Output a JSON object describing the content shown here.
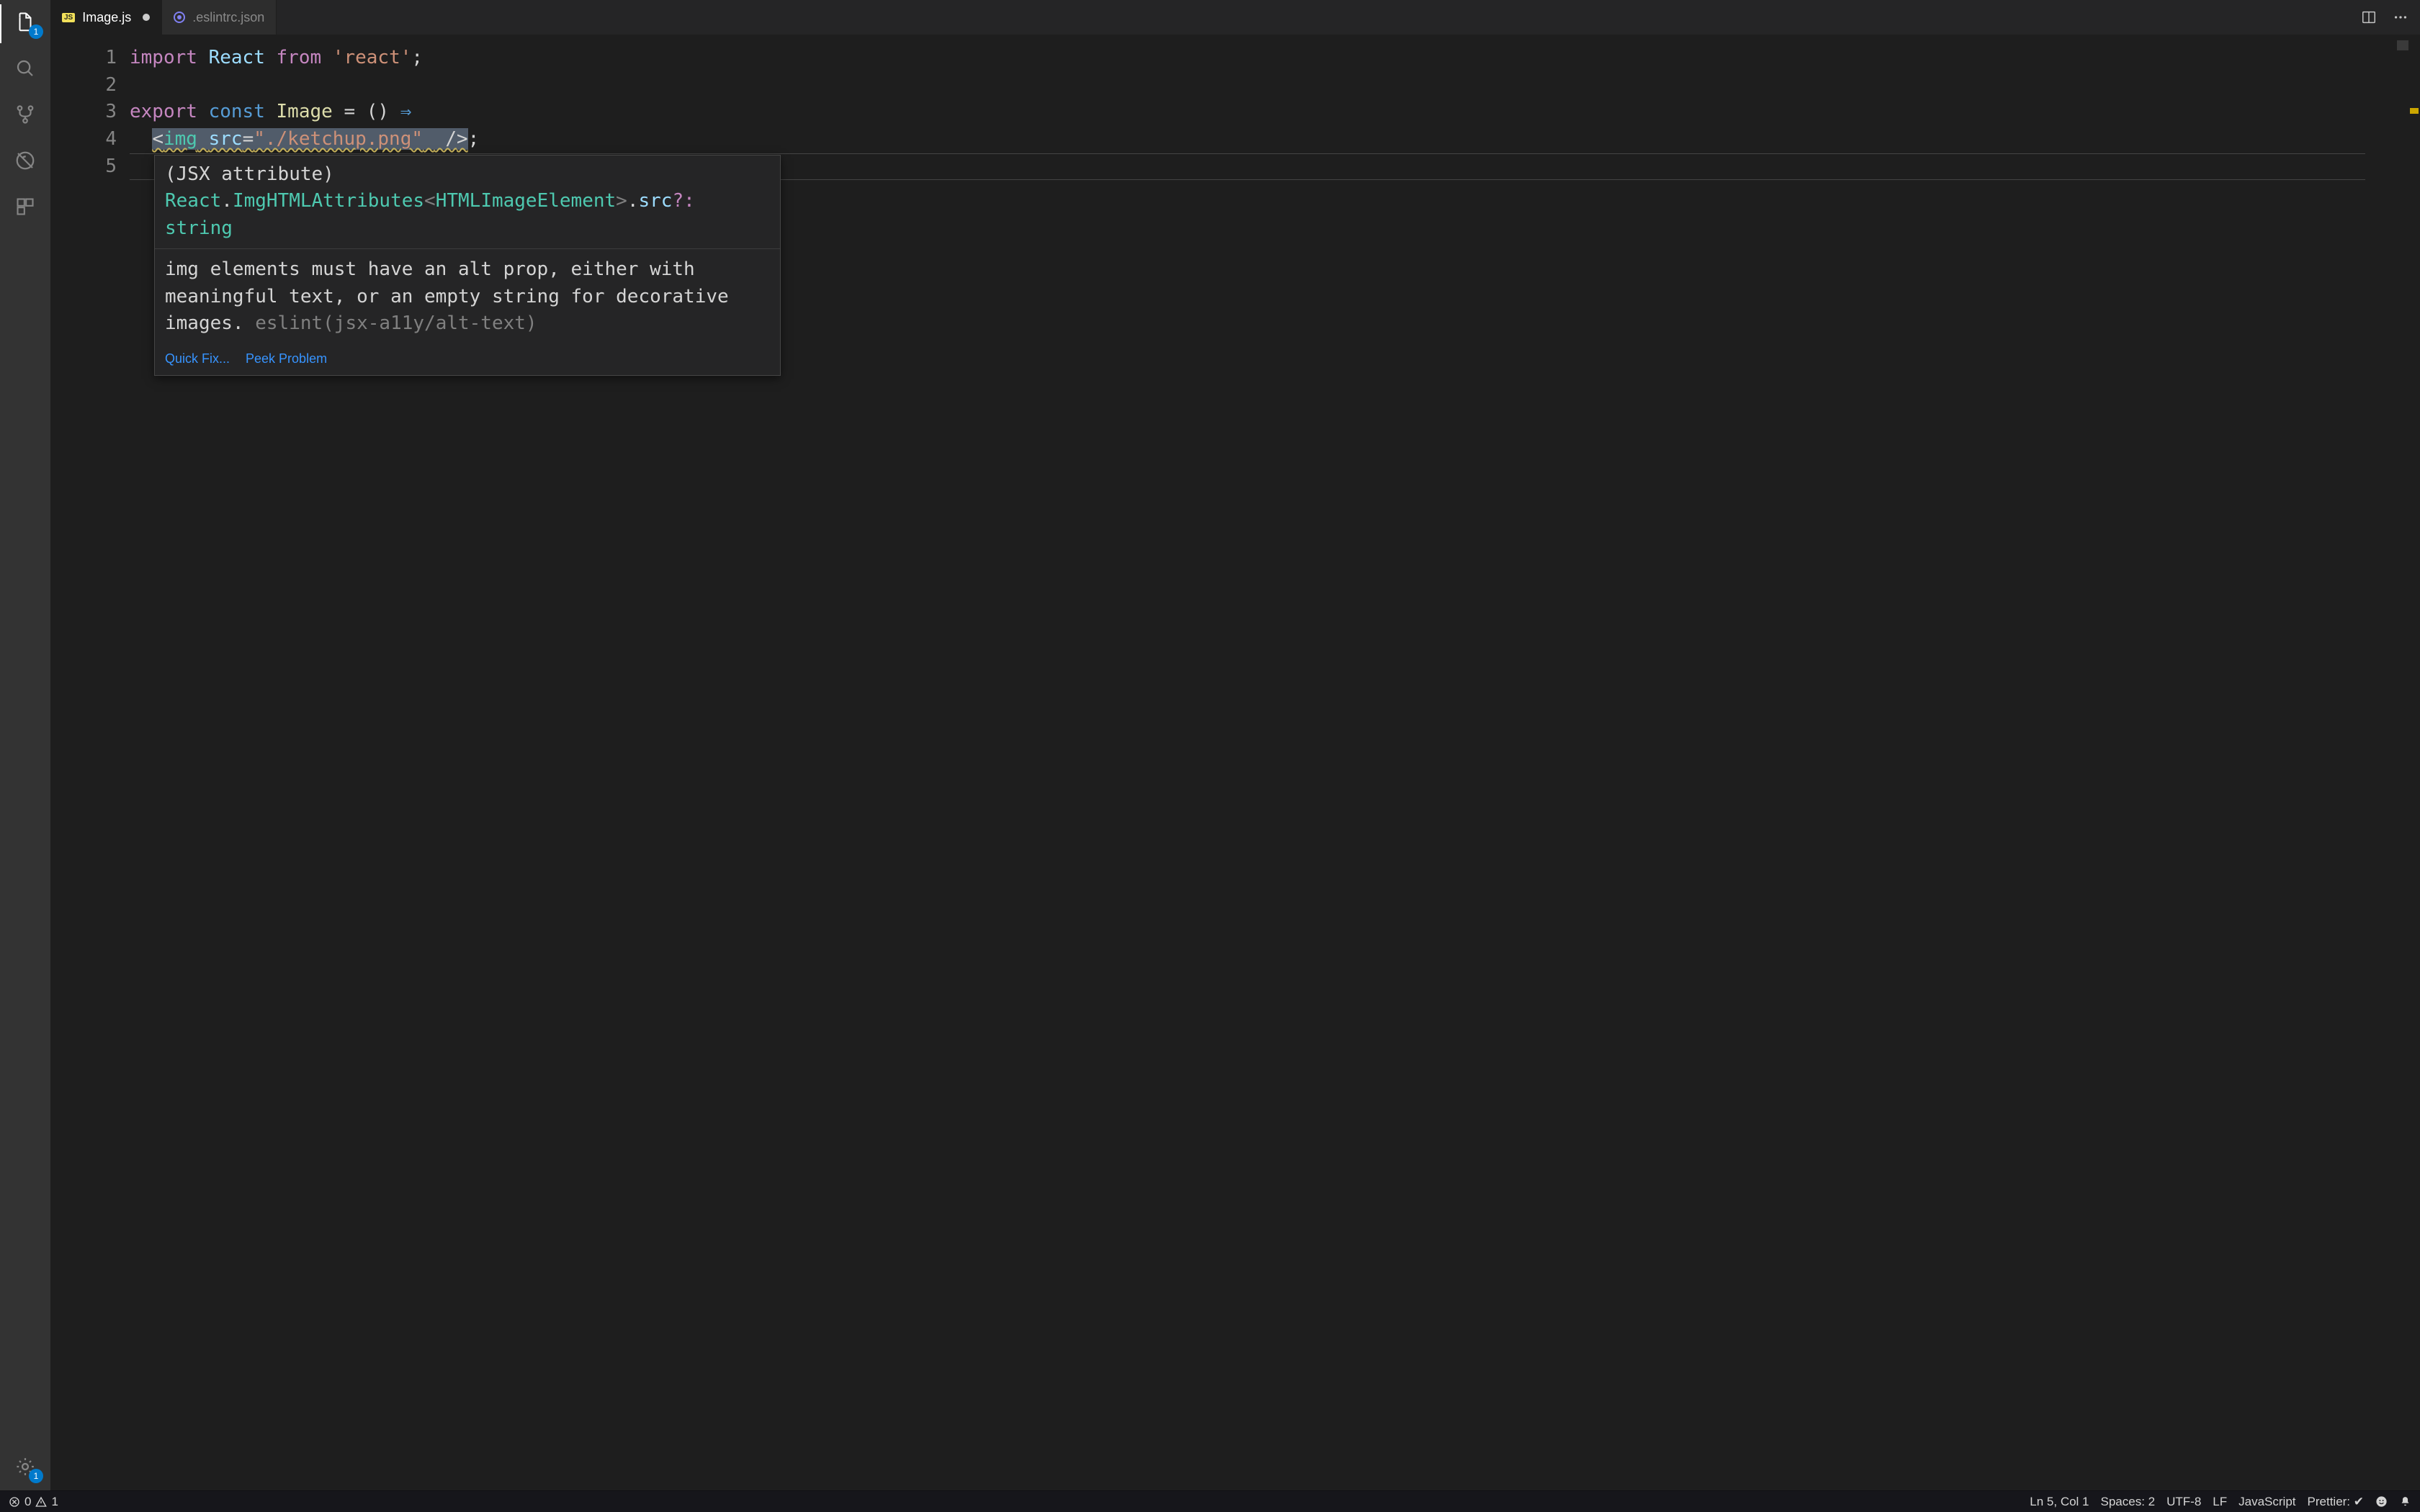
{
  "activity": {
    "explorer_badge": "1",
    "settings_badge": "1"
  },
  "tabs": [
    {
      "icon": "js",
      "label": "Image.js",
      "active": true,
      "dirty": true
    },
    {
      "icon": "eslint",
      "label": ".eslintrc.json",
      "active": false,
      "dirty": false
    }
  ],
  "gutter": [
    "1",
    "2",
    "3",
    "4",
    "5"
  ],
  "code": {
    "l1": {
      "import": "import",
      "default": "React",
      "from": "from",
      "str": "'react'",
      "semi": ";"
    },
    "l3": {
      "export": "export",
      "const": "const",
      "name": "Image",
      "eq": "=",
      "parens": "()",
      "arrow": "⇒"
    },
    "l4": {
      "indent": "  ",
      "open": "<",
      "tag": "img",
      "sp": " ",
      "attr": "src",
      "eq": "=",
      "val": "\"./ketchup.png\"",
      "sp2": " ",
      "slash": " /",
      "close": ">",
      "semi": ";"
    }
  },
  "hover": {
    "sig_open": "(",
    "sig_kind": "JSX attribute",
    "sig_close": ")",
    "sig_sp": " ",
    "sig_ns": "React",
    "sig_dot1": ".",
    "sig_cls": "ImgHTMLAttributes",
    "sig_lt": "<",
    "sig_arg": "HTMLImageElement",
    "sig_gt": ">",
    "sig_dot2": ".",
    "sig_prop": "src",
    "sig_opt": "?:",
    "sig_sp2": " ",
    "sig_type": "string",
    "message": "img elements must have an alt prop, either with meaningful text, or an empty string for decorative images. ",
    "rule": "eslint(jsx-a11y/alt-text)",
    "action_quickfix": "Quick Fix...",
    "action_peek": "Peek Problem"
  },
  "status": {
    "errors": "0",
    "warnings": "1",
    "cursor": "Ln 5, Col 1",
    "spaces": "Spaces: 2",
    "encoding": "UTF-8",
    "eol": "LF",
    "language": "JavaScript",
    "prettier": "Prettier: ✔"
  }
}
